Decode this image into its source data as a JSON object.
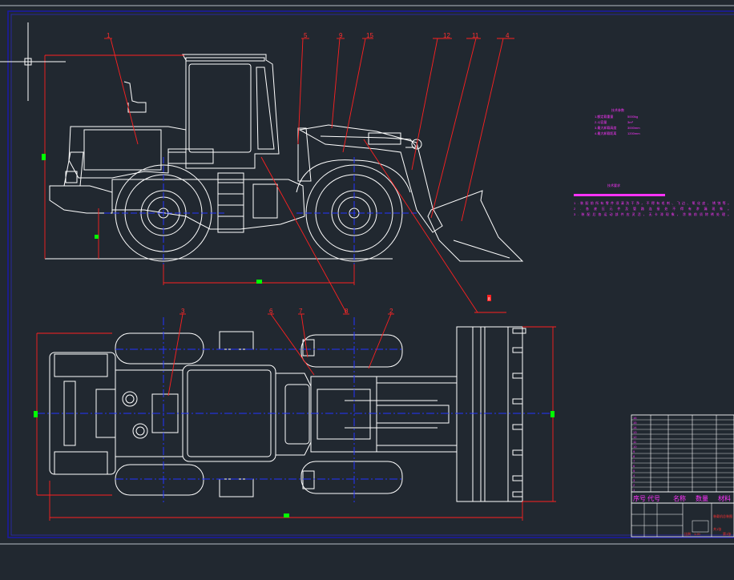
{
  "colors": {
    "background": "#212830",
    "geometry": "#ffffff",
    "leader": "#ff0000",
    "centerline": "#2233ff",
    "dimension_marker": "#00ff00",
    "note_text": "#ff00ff",
    "frame": "#1a1aa0"
  },
  "side_view_labels": [
    "1",
    "5",
    "9",
    "15",
    "12",
    "11",
    "4"
  ],
  "top_view_labels": [
    "3",
    "6",
    "7",
    "8",
    "2"
  ],
  "callout_marker": "8",
  "tech_params": {
    "title": "技术参数",
    "rows": [
      {
        "name": "1.额定载重量",
        "value": "5000kg"
      },
      {
        "name": "2.斗容量",
        "value": "3m³"
      },
      {
        "name": "3.最大卸载高度",
        "value": "3000mm"
      },
      {
        "name": "4.最大卸载距离",
        "value": "1200mm"
      }
    ]
  },
  "tech_requirements": {
    "title": "技术要求",
    "lines": [
      "1.装配前所有零件须清洗干净，不得有毛刺、飞边、氧化皮、锈蚀等。",
      "2.各液压元件及管路连接处不得有渗漏现象。",
      "3.装配后各运动部件应灵活，无卡滞现象，涂装前须除锈处理。"
    ]
  },
  "bom_header": [
    "序号",
    "代号",
    "名称",
    "数量",
    "材料"
  ],
  "bom_rows": [
    "16",
    "15",
    "14",
    "13",
    "12",
    "11",
    "10",
    "9",
    "8",
    "7",
    "6",
    "5",
    "4",
    "3",
    "2",
    "1"
  ],
  "title_block": [
    "装载机总装图",
    "比例",
    "1:20",
    "共1张",
    "第1张"
  ],
  "icon": "crosshair-cursor-icon"
}
